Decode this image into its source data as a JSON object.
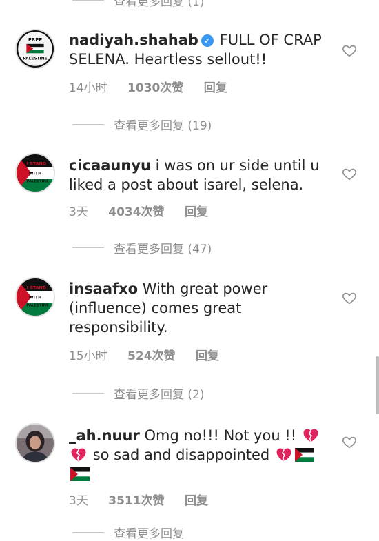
{
  "view_more_replies": [
    "查看更多回复 (1)",
    "查看更多回复 (19)",
    "查看更多回复 (47)",
    "查看更多回复 (2)",
    "查看更多回复"
  ],
  "comments": [
    {
      "username": "nadiyah.shahab",
      "verified": true,
      "line1": "FULL OF CRAP",
      "line2": "SELENA. Heartless sellout!!",
      "time": "14小时",
      "likes": "1030次赞",
      "reply": "回复",
      "avatar_text_top": "FREE",
      "avatar_text_bottom": "PALESTINE"
    },
    {
      "username": "cicaaunyu",
      "line1": "i was on ur side until u",
      "line2": "liked a post about isarel, selena.",
      "time": "3天",
      "likes": "4034次赞",
      "reply": "回复",
      "avatar_text_1": "I STAND",
      "avatar_text_2": "WITH",
      "avatar_text_3": "PALESTINE"
    },
    {
      "username": "insaafxo",
      "line1": "With great power",
      "line2": "(influence) comes great",
      "line3": "responsibility.",
      "time": "15小时",
      "likes": "524次赞",
      "reply": "回复",
      "avatar_text_1": "I STAND",
      "avatar_text_2": "WITH",
      "avatar_text_3": "PALESTINE"
    },
    {
      "username": "_ah.nuur",
      "line1": "Omg no!!! Not you !!",
      "line2": "so sad and disappointed",
      "time": "3天",
      "likes": "3511次赞",
      "reply": "回复"
    }
  ],
  "icons": {
    "like": "heart-outline-icon",
    "verified": "verified-badge-icon",
    "broken_heart": "broken-heart-emoji",
    "flag": "palestine-flag-emoji"
  },
  "colors": {
    "text": "#262626",
    "meta": "#8e8e8e",
    "verified": "#3897f0",
    "broken_heart": "#e0245e",
    "flag_red": "#ce1126",
    "flag_green": "#007a3d"
  }
}
